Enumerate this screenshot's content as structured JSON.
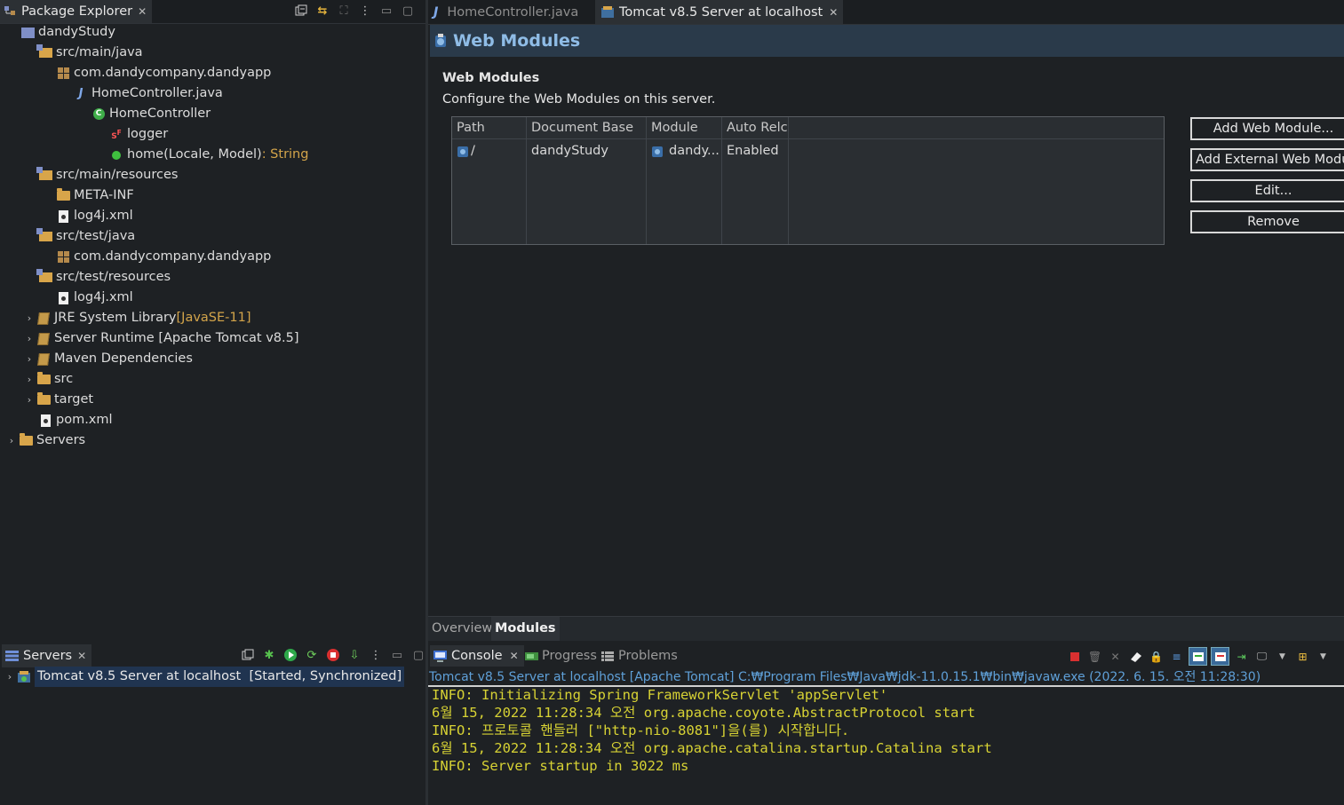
{
  "package_explorer": {
    "title": "Package Explorer",
    "tree": [
      {
        "label": "dandyStudy",
        "icon": "project-icon",
        "decoration": ""
      },
      {
        "label": "src/main/java",
        "icon": "source-folder-icon",
        "decoration": ""
      },
      {
        "label": "com.dandycompany.dandyapp",
        "icon": "package-icon",
        "decoration": ""
      },
      {
        "label": "HomeController.java",
        "icon": "java-file-icon",
        "decoration": ""
      },
      {
        "label": "HomeController",
        "icon": "class-icon",
        "decoration": ""
      },
      {
        "label": "logger",
        "icon": "static-final-field-icon",
        "decoration": ""
      },
      {
        "label": "home(Locale, Model)",
        "icon": "public-method-icon",
        "decoration": " : String"
      },
      {
        "label": "src/main/resources",
        "icon": "source-folder-icon",
        "decoration": ""
      },
      {
        "label": "META-INF",
        "icon": "folder-icon",
        "decoration": ""
      },
      {
        "label": "log4j.xml",
        "icon": "xml-file-icon",
        "decoration": ""
      },
      {
        "label": "src/test/java",
        "icon": "source-folder-icon",
        "decoration": ""
      },
      {
        "label": "com.dandycompany.dandyapp",
        "icon": "package-icon",
        "decoration": ""
      },
      {
        "label": "src/test/resources",
        "icon": "source-folder-icon",
        "decoration": ""
      },
      {
        "label": "log4j.xml",
        "icon": "xml-file-icon",
        "decoration": ""
      },
      {
        "label": "JRE System Library",
        "icon": "library-icon",
        "decoration": " [JavaSE-11]"
      },
      {
        "label": "Server Runtime [Apache Tomcat v8.5]",
        "icon": "library-icon",
        "decoration": ""
      },
      {
        "label": "Maven Dependencies",
        "icon": "library-icon",
        "decoration": ""
      },
      {
        "label": "src",
        "icon": "folder-icon",
        "decoration": ""
      },
      {
        "label": "target",
        "icon": "folder-icon",
        "decoration": ""
      },
      {
        "label": "pom.xml",
        "icon": "xml-file-icon",
        "decoration": ""
      },
      {
        "label": "Servers",
        "icon": "folder-icon",
        "decoration": ""
      }
    ]
  },
  "servers_view": {
    "title": "Servers",
    "server_name": "Tomcat v8.5 Server at localhost",
    "server_state": "[Started, Synchronized]"
  },
  "editor": {
    "tabs": [
      {
        "label": "HomeController.java",
        "active": false
      },
      {
        "label": "Tomcat v8.5 Server at localhost",
        "active": true
      }
    ],
    "form_title": "Web Modules",
    "section_title": "Web Modules",
    "section_description": "Configure the Web Modules on this server.",
    "table": {
      "columns": [
        "Path",
        "Document Base",
        "Module",
        "Auto Relc"
      ],
      "rows": [
        {
          "path": "/",
          "document_base": "dandyStudy",
          "module": "dandy...",
          "auto_reload": "Enabled"
        }
      ]
    },
    "buttons": {
      "add_web_module": "Add Web Module...",
      "add_external_web_module": "Add External Web Module",
      "edit": "Edit...",
      "remove": "Remove"
    },
    "bottom_tabs": [
      {
        "label": "Overview",
        "active": false
      },
      {
        "label": "Modules",
        "active": true
      }
    ]
  },
  "console": {
    "tabs": [
      {
        "label": "Console",
        "active": true
      },
      {
        "label": "Progress",
        "active": false
      },
      {
        "label": "Problems",
        "active": false
      }
    ],
    "description": "Tomcat v8.5 Server at localhost [Apache Tomcat] C:₩Program Files₩Java₩jdk-11.0.15.1₩bin₩javaw.exe  (2022. 6. 15. 오전 11:28:30)",
    "lines": [
      "INFO: Initializing Spring FrameworkServlet 'appServlet'",
      "6월 15, 2022 11:28:34 오전 org.apache.coyote.AbstractProtocol start",
      "INFO: 프로토콜 핸들러 [\"http-nio-8081\"]을(를) 시작합니다.",
      "6월 15, 2022 11:28:34 오전 org.apache.catalina.startup.Catalina start",
      "INFO: Server startup in 3022 ms"
    ]
  },
  "colors": {
    "background": "#1e2124",
    "console_text": "#d7d234",
    "console_description": "#5fa0d8",
    "form_title": "#8fbce6",
    "decoration": "#d3a44a"
  }
}
